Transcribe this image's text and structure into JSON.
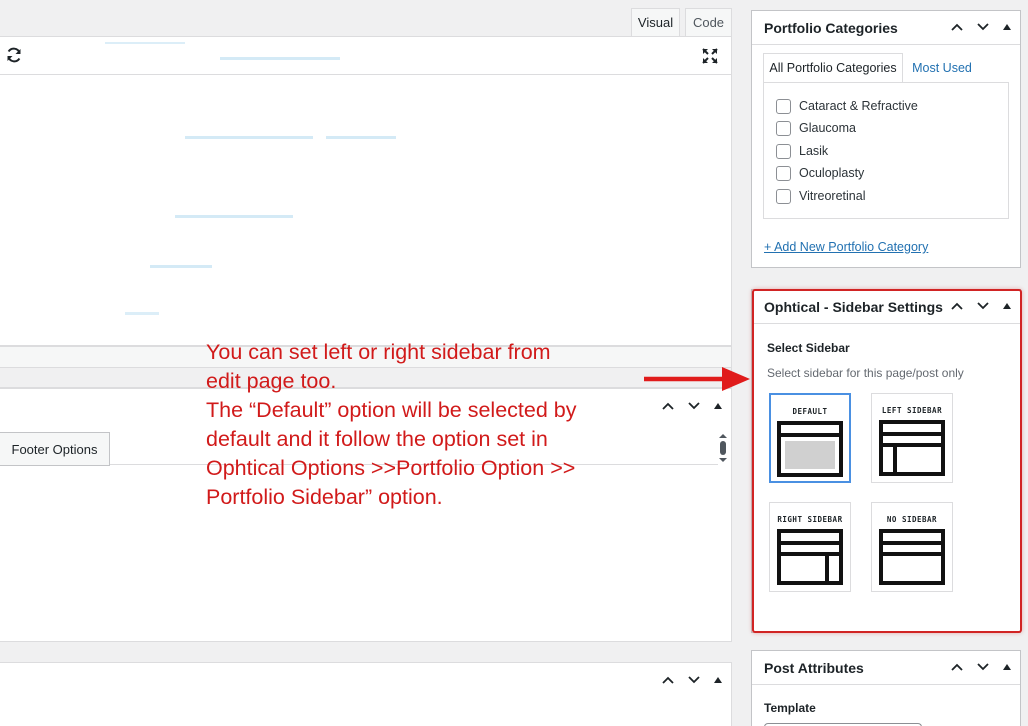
{
  "editor": {
    "tabs": [
      "Visual",
      "Code"
    ],
    "active_tab": "Visual",
    "footer_tab_label": "Footer Options"
  },
  "annotation": {
    "lines": [
      "You can set left or right sidebar from",
      "edit page too.",
      "The “Default” option will be selected by",
      "default and it follow the option set in",
      "Ophtical Options >>Portfolio Option >>",
      "Portfolio Sidebar” option."
    ],
    "color": "#d11a1a"
  },
  "portfolio_categories": {
    "title": "Portfolio Categories",
    "tabs": [
      "All Portfolio Categories",
      "Most Used"
    ],
    "items": [
      "Cataract & Refractive",
      "Glaucoma",
      "Lasik",
      "Oculoplasty",
      "Vitreoretinal"
    ],
    "add_link": "+ Add New Portfolio Category"
  },
  "sidebar_settings": {
    "title": "Ophtical - Sidebar Settings",
    "label": "Select Sidebar",
    "hint": "Select sidebar for this page/post only",
    "options": [
      "DEFAULT",
      "LEFT SIDEBAR",
      "RIGHT SIDEBAR",
      "NO SIDEBAR"
    ],
    "selected": "DEFAULT",
    "highlight_color": "#d12424"
  },
  "post_attributes": {
    "title": "Post Attributes",
    "template_label": "Template"
  },
  "icons": [
    "refresh-icon",
    "fullscreen-icon",
    "chevron-up-icon",
    "chevron-down-icon",
    "triangle-up-icon"
  ]
}
